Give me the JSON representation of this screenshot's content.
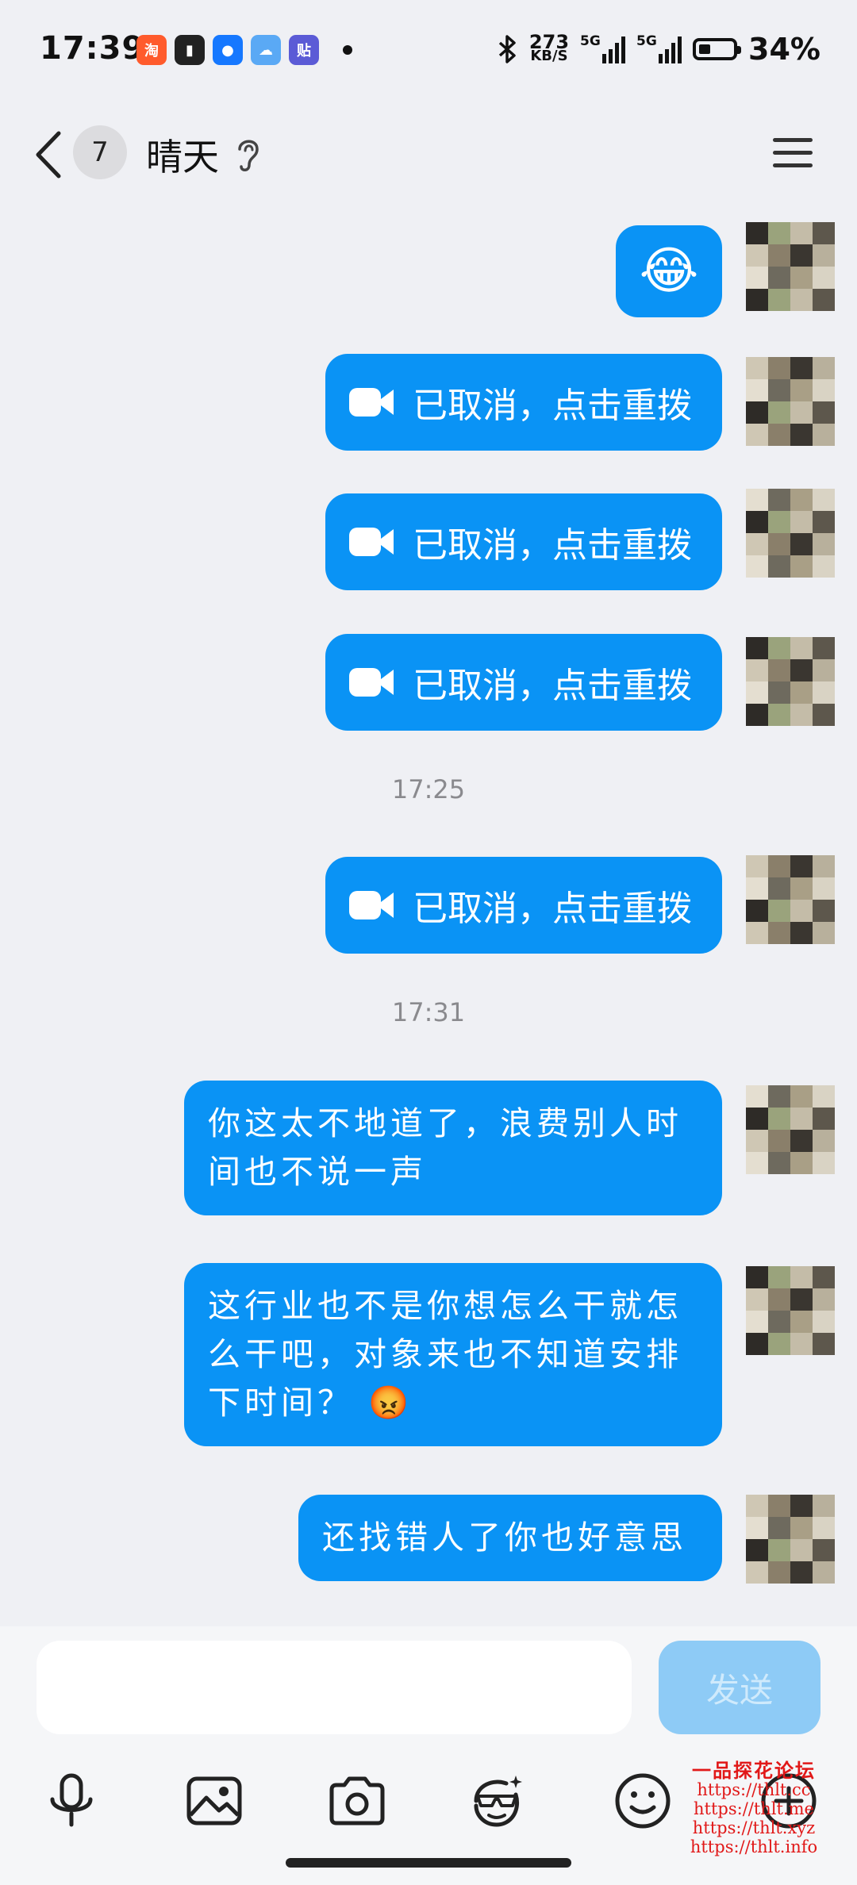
{
  "status_bar": {
    "time": "17:39",
    "net_speed_value": "273",
    "net_speed_unit": "KB/S",
    "sim1": "5G",
    "sim2": "5G",
    "battery_pct": "34%",
    "battery_level": 0.34
  },
  "header": {
    "unread_count": "7",
    "contact_name": "晴天"
  },
  "messages": {
    "m1_emoji": "😂",
    "m2_text": "已取消，点击重拨",
    "m3_text": "已取消，点击重拨",
    "m4_text": "已取消，点击重拨",
    "ts1": "17:25",
    "m5_text": "已取消，点击重拨",
    "ts2": "17:31",
    "m6_text": "你这太不地道了，浪费别人时间也不说一声",
    "m7_text": "这行业也不是你想怎么干就怎么干吧，对象来也不知道安排下时间？",
    "m7_emoji": "😡",
    "m8_text": "还找错人了你也好意思"
  },
  "composer": {
    "placeholder": "",
    "send_label": "发送"
  },
  "toolbar": {
    "icons": [
      "mic-icon",
      "image-icon",
      "camera-icon",
      "cool-emoji-icon",
      "smiley-icon",
      "plus-icon"
    ]
  },
  "watermark": {
    "title": "一品探花论坛",
    "urls": [
      "https://thlt.cc",
      "https://thlt.me",
      "https://thlt.xyz",
      "https://thlt.info"
    ]
  },
  "colors": {
    "bubble": "#0a93f5",
    "background": "#eff0f4",
    "send_disabled": "#8ecbf6"
  }
}
